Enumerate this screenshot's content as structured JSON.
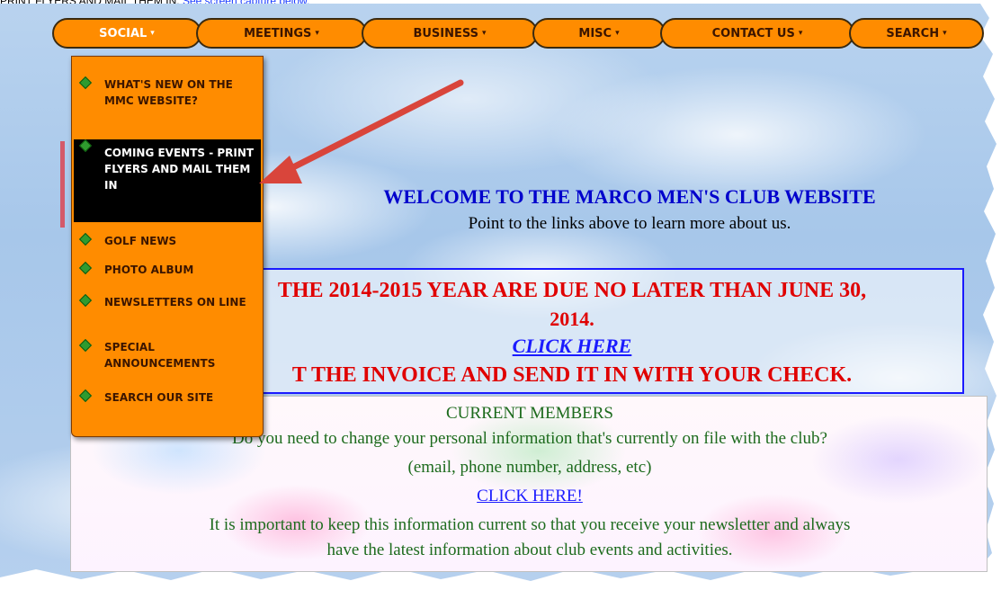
{
  "caption": {
    "text": "PRINT FLYERS AND MAIL THEM IN.",
    "link_text": "See screen capture below."
  },
  "nav": {
    "tabs": [
      {
        "label": "SOCIAL"
      },
      {
        "label": "MEETINGS"
      },
      {
        "label": "BUSINESS"
      },
      {
        "label": "MISC"
      },
      {
        "label": "CONTACT US"
      },
      {
        "label": "SEARCH"
      }
    ],
    "caret": "▾"
  },
  "dropdown": {
    "items": [
      {
        "label": "WHAT'S NEW ON THE MMC WEBSITE?"
      },
      {
        "label": "COMING EVENTS - PRINT FLYERS AND MAIL THEM IN"
      },
      {
        "label": "GOLF NEWS"
      },
      {
        "label": "PHOTO ALBUM"
      },
      {
        "label": "NEWSLETTERS ON LINE"
      },
      {
        "label": "SPECIAL ANNOUNCEMENTS"
      },
      {
        "label": "SEARCH OUR SITE"
      }
    ]
  },
  "welcome": {
    "title": "WELCOME TO THE MARCO MEN'S CLUB WEBSITE",
    "subtitle": "Point to the links above to learn more about us."
  },
  "dues": {
    "line1": "THE 2014-2015 YEAR ARE DUE NO LATER THAN JUNE 30,",
    "line2": "2014.",
    "link": "CLICK HERE",
    "line3": "T THE INVOICE AND SEND IT IN WITH YOUR CHECK."
  },
  "members": {
    "title": "CURRENT MEMBERS",
    "question": "Do you need to change your personal information that's currently on file with the club?",
    "examples": "(email, phone number, address, etc)",
    "link": "CLICK HERE!",
    "note1": "It is important to keep this information current so that you receive your newsletter and always",
    "note2": "have the latest information about club events and activities."
  },
  "colors": {
    "nav_orange": "#ff8c00",
    "highlight": "#000000",
    "arrow_red": "#d9453b",
    "welcome_blue": "#0000cc",
    "dues_red": "#e00000",
    "members_green": "#1d6b1d"
  }
}
